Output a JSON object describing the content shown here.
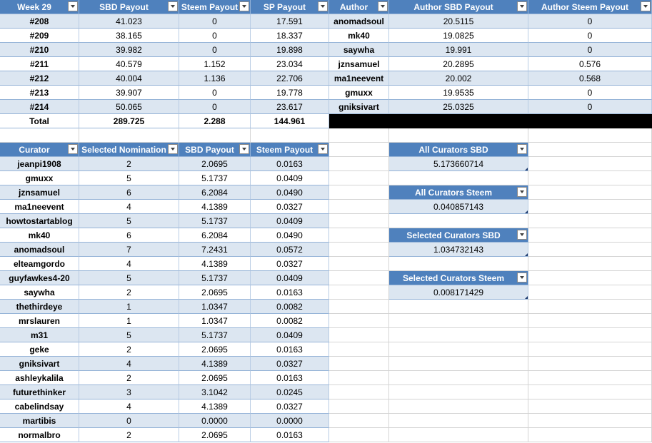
{
  "weekly_table": {
    "headers": [
      "Week 29",
      "SBD Payout",
      "Steem Payout",
      "SP Payout",
      "Author",
      "Author SBD Payout",
      "Author Steem Payout"
    ],
    "rows": [
      [
        "#208",
        "41.023",
        "0",
        "17.591",
        "anomadsoul",
        "20.5115",
        "0"
      ],
      [
        "#209",
        "38.165",
        "0",
        "18.337",
        "mk40",
        "19.0825",
        "0"
      ],
      [
        "#210",
        "39.982",
        "0",
        "19.898",
        "saywha",
        "19.991",
        "0"
      ],
      [
        "#211",
        "40.579",
        "1.152",
        "23.034",
        "jznsamuel",
        "20.2895",
        "0.576"
      ],
      [
        "#212",
        "40.004",
        "1.136",
        "22.706",
        "ma1neevent",
        "20.002",
        "0.568"
      ],
      [
        "#213",
        "39.907",
        "0",
        "19.778",
        "gmuxx",
        "19.9535",
        "0"
      ],
      [
        "#214",
        "50.065",
        "0",
        "23.617",
        "gniksivart",
        "25.0325",
        "0"
      ]
    ],
    "total": [
      "Total",
      "289.725",
      "2.288",
      "144.961"
    ]
  },
  "curator_table": {
    "headers": [
      "Curator",
      "Selected Nomination",
      "SBD Payout",
      "Steem Payout"
    ],
    "rows": [
      [
        "jeanpi1908",
        "2",
        "2.0695",
        "0.0163"
      ],
      [
        "gmuxx",
        "5",
        "5.1737",
        "0.0409"
      ],
      [
        "jznsamuel",
        "6",
        "6.2084",
        "0.0490"
      ],
      [
        "ma1neevent",
        "4",
        "4.1389",
        "0.0327"
      ],
      [
        "howtostartablog",
        "5",
        "5.1737",
        "0.0409"
      ],
      [
        "mk40",
        "6",
        "6.2084",
        "0.0490"
      ],
      [
        "anomadsoul",
        "7",
        "7.2431",
        "0.0572"
      ],
      [
        "elteamgordo",
        "4",
        "4.1389",
        "0.0327"
      ],
      [
        "guyfawkes4-20",
        "5",
        "5.1737",
        "0.0409"
      ],
      [
        "saywha",
        "2",
        "2.0695",
        "0.0163"
      ],
      [
        "thethirdeye",
        "1",
        "1.0347",
        "0.0082"
      ],
      [
        "mrslauren",
        "1",
        "1.0347",
        "0.0082"
      ],
      [
        "m31",
        "5",
        "5.1737",
        "0.0409"
      ],
      [
        "geke",
        "2",
        "2.0695",
        "0.0163"
      ],
      [
        "gniksivart",
        "4",
        "4.1389",
        "0.0327"
      ],
      [
        "ashleykalila",
        "2",
        "2.0695",
        "0.0163"
      ],
      [
        "futurethinker",
        "3",
        "3.1042",
        "0.0245"
      ],
      [
        "cabelindsay",
        "4",
        "4.1389",
        "0.0327"
      ],
      [
        "martibis",
        "0",
        "0.0000",
        "0.0000"
      ],
      [
        "normalbro",
        "2",
        "2.0695",
        "0.0163"
      ]
    ]
  },
  "summary_boxes": [
    {
      "label": "All Curators SBD",
      "value": "5.173660714"
    },
    {
      "label": "All Curators Steem",
      "value": "0.040857143"
    },
    {
      "label": "Selected Curators SBD",
      "value": "1.034732143"
    },
    {
      "label": "Selected Curators Steem",
      "value": "0.008171429"
    }
  ],
  "icons": {
    "filter_dropdown": "chevron-down-icon"
  },
  "colors": {
    "header": "#4f81bd",
    "band": "#dce6f1",
    "redaction": "#000000"
  }
}
